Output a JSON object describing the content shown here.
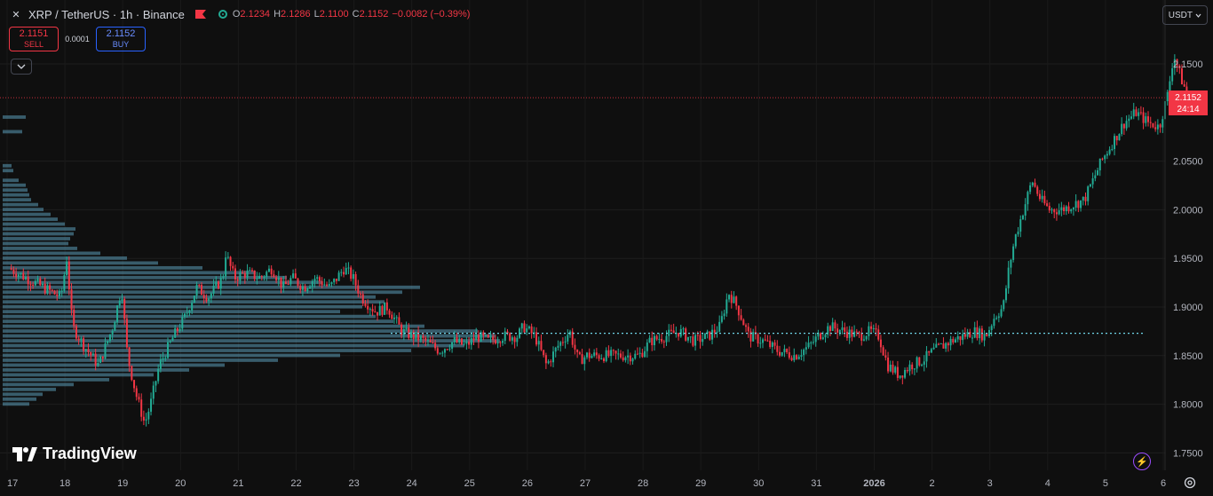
{
  "header": {
    "symbol_title": "XRP / TetherUS · 1h · Binance",
    "ohlc": {
      "o_label": "O",
      "o_value": "2.1234",
      "h_label": "H",
      "h_value": "2.1286",
      "l_label": "L",
      "l_value": "2.1100",
      "c_label": "C",
      "c_value": "2.1152",
      "change": "−0.0082 (−0.39%)"
    }
  },
  "trade": {
    "sell_price": "2.1151",
    "sell_label": "SELL",
    "spread": "0.0001",
    "buy_price": "2.1152",
    "buy_label": "BUY"
  },
  "currency_selector": {
    "label": "USDT"
  },
  "price_label": {
    "price": "2.1152",
    "countdown": "24:14"
  },
  "logo_text": "TradingView",
  "colors": {
    "up": "#22ab94",
    "down": "#f23645",
    "volume_profile": "#5b9cb8"
  },
  "chart_data": {
    "type": "candlestick",
    "y_ticks": [
      "2.1500",
      "2.0500",
      "2.0000",
      "1.9500",
      "1.9000",
      "1.8500",
      "1.8000",
      "1.7500"
    ],
    "ylim": [
      1.73,
      2.185
    ],
    "x_ticks": [
      "17",
      "18",
      "19",
      "20",
      "21",
      "22",
      "23",
      "24",
      "25",
      "26",
      "27",
      "28",
      "29",
      "30",
      "31",
      "2026",
      "2",
      "3",
      "4",
      "5",
      "6"
    ],
    "last_price": 2.1152,
    "poc_price": 1.873,
    "close_path": [
      [
        17.0,
        1.94
      ],
      [
        17.3,
        1.93
      ],
      [
        17.6,
        1.92
      ],
      [
        17.9,
        1.91
      ],
      [
        18.0,
        1.95
      ],
      [
        18.1,
        1.88
      ],
      [
        18.3,
        1.86
      ],
      [
        18.55,
        1.84
      ],
      [
        18.8,
        1.88
      ],
      [
        18.95,
        1.92
      ],
      [
        19.05,
        1.85
      ],
      [
        19.2,
        1.81
      ],
      [
        19.35,
        1.78
      ],
      [
        19.45,
        1.8
      ],
      [
        19.6,
        1.84
      ],
      [
        19.85,
        1.87
      ],
      [
        20.05,
        1.89
      ],
      [
        20.25,
        1.92
      ],
      [
        20.45,
        1.91
      ],
      [
        20.7,
        1.93
      ],
      [
        20.75,
        1.955
      ],
      [
        20.9,
        1.93
      ],
      [
        21.1,
        1.935
      ],
      [
        21.35,
        1.93
      ],
      [
        21.55,
        1.94
      ],
      [
        21.75,
        1.92
      ],
      [
        21.9,
        1.93
      ],
      [
        22.1,
        1.92
      ],
      [
        22.3,
        1.93
      ],
      [
        22.55,
        1.92
      ],
      [
        22.8,
        1.94
      ],
      [
        22.95,
        1.93
      ],
      [
        23.1,
        1.91
      ],
      [
        23.35,
        1.895
      ],
      [
        23.55,
        1.9
      ],
      [
        23.8,
        1.875
      ],
      [
        24.0,
        1.87
      ],
      [
        24.2,
        1.865
      ],
      [
        24.45,
        1.855
      ],
      [
        24.7,
        1.865
      ],
      [
        24.9,
        1.86
      ],
      [
        25.1,
        1.87
      ],
      [
        25.3,
        1.865
      ],
      [
        25.55,
        1.87
      ],
      [
        25.8,
        1.87
      ],
      [
        25.9,
        1.88
      ],
      [
        26.1,
        1.87
      ],
      [
        26.3,
        1.84
      ],
      [
        26.5,
        1.86
      ],
      [
        26.7,
        1.875
      ],
      [
        26.85,
        1.845
      ],
      [
        27.0,
        1.85
      ],
      [
        27.3,
        1.85
      ],
      [
        27.6,
        1.85
      ],
      [
        27.9,
        1.85
      ],
      [
        28.1,
        1.865
      ],
      [
        28.35,
        1.87
      ],
      [
        28.6,
        1.875
      ],
      [
        28.85,
        1.865
      ],
      [
        29.1,
        1.87
      ],
      [
        29.3,
        1.88
      ],
      [
        29.45,
        1.915
      ],
      [
        29.6,
        1.9
      ],
      [
        29.8,
        1.87
      ],
      [
        30.05,
        1.865
      ],
      [
        30.3,
        1.855
      ],
      [
        30.6,
        1.85
      ],
      [
        30.85,
        1.86
      ],
      [
        31.0,
        1.87
      ],
      [
        31.2,
        1.88
      ],
      [
        31.45,
        1.875
      ],
      [
        31.7,
        1.87
      ],
      [
        31.9,
        1.875
      ],
      [
        32.05,
        1.87
      ],
      [
        32.2,
        1.84
      ],
      [
        32.4,
        1.83
      ],
      [
        32.6,
        1.84
      ],
      [
        32.8,
        1.845
      ],
      [
        33.0,
        1.855
      ],
      [
        33.3,
        1.865
      ],
      [
        33.5,
        1.87
      ],
      [
        33.7,
        1.875
      ],
      [
        33.9,
        1.87
      ],
      [
        34.05,
        1.89
      ],
      [
        34.2,
        1.9
      ],
      [
        34.3,
        1.94
      ],
      [
        34.4,
        1.97
      ],
      [
        34.55,
        2.0
      ],
      [
        34.7,
        2.03
      ],
      [
        34.85,
        2.01
      ],
      [
        35.0,
        2.0
      ],
      [
        35.2,
        2.0
      ],
      [
        35.4,
        2.005
      ],
      [
        35.6,
        2.01
      ],
      [
        35.75,
        2.03
      ],
      [
        35.9,
        2.05
      ],
      [
        36.1,
        2.07
      ],
      [
        36.3,
        2.09
      ],
      [
        36.5,
        2.1
      ],
      [
        36.7,
        2.09
      ],
      [
        36.9,
        2.085
      ],
      [
        37.05,
        2.12
      ],
      [
        37.15,
        2.16
      ],
      [
        37.25,
        2.14
      ],
      [
        37.4,
        2.1152
      ]
    ],
    "volume_profile": [
      [
        2.095,
        26
      ],
      [
        2.08,
        22
      ],
      [
        2.045,
        10
      ],
      [
        2.04,
        12
      ],
      [
        2.03,
        18
      ],
      [
        2.025,
        26
      ],
      [
        2.02,
        28
      ],
      [
        2.015,
        30
      ],
      [
        2.01,
        32
      ],
      [
        2.005,
        40
      ],
      [
        2.0,
        46
      ],
      [
        1.995,
        54
      ],
      [
        1.99,
        62
      ],
      [
        1.985,
        70
      ],
      [
        1.98,
        82
      ],
      [
        1.975,
        80
      ],
      [
        1.97,
        76
      ],
      [
        1.965,
        74
      ],
      [
        1.96,
        84
      ],
      [
        1.955,
        110
      ],
      [
        1.95,
        140
      ],
      [
        1.945,
        175
      ],
      [
        1.94,
        225
      ],
      [
        1.935,
        285
      ],
      [
        1.93,
        320
      ],
      [
        1.925,
        360
      ],
      [
        1.92,
        470
      ],
      [
        1.915,
        450
      ],
      [
        1.91,
        420
      ],
      [
        1.905,
        430
      ],
      [
        1.9,
        405
      ],
      [
        1.895,
        380
      ],
      [
        1.89,
        420
      ],
      [
        1.885,
        440
      ],
      [
        1.88,
        475
      ],
      [
        1.875,
        535
      ],
      [
        1.87,
        555
      ],
      [
        1.865,
        560
      ],
      [
        1.86,
        520
      ],
      [
        1.855,
        460
      ],
      [
        1.85,
        380
      ],
      [
        1.845,
        310
      ],
      [
        1.84,
        250
      ],
      [
        1.835,
        210
      ],
      [
        1.83,
        170
      ],
      [
        1.825,
        120
      ],
      [
        1.82,
        80
      ],
      [
        1.815,
        60
      ],
      [
        1.81,
        45
      ],
      [
        1.805,
        38
      ],
      [
        1.8,
        30
      ]
    ]
  }
}
